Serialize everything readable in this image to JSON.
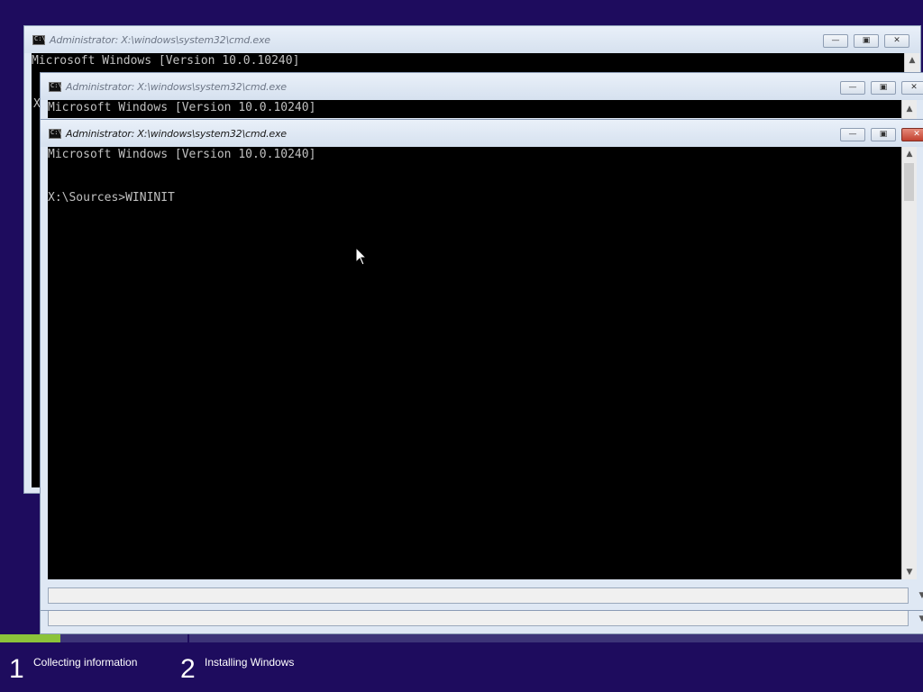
{
  "windows": [
    {
      "title": "Administrator: X:\\windows\\system32\\cmd.exe",
      "lines": [
        "Microsoft Windows [Version 10.0.10240]"
      ],
      "partial_char": "X"
    },
    {
      "title": "Administrator: X:\\windows\\system32\\cmd.exe",
      "lines": [
        "Microsoft Windows [Version 10.0.10240]"
      ]
    },
    {
      "title": "Administrator: X:\\windows\\system32\\cmd.exe",
      "lines": [
        "Microsoft Windows [Version 10.0.10240]",
        "",
        "X:\\Sources>WININIT"
      ]
    }
  ],
  "controls": {
    "minimize": "—",
    "maximize": "▣",
    "close": "✕"
  },
  "setup": {
    "progress": 0.065,
    "steps": [
      {
        "number": "1",
        "label": "Collecting information"
      },
      {
        "number": "2",
        "label": "Installing Windows"
      }
    ]
  },
  "icons": {
    "window_icon": "cmd-icon",
    "cursor": "mouse-pointer-icon",
    "scroll_up": "up-arrow-icon",
    "scroll_down": "down-arrow-icon"
  }
}
